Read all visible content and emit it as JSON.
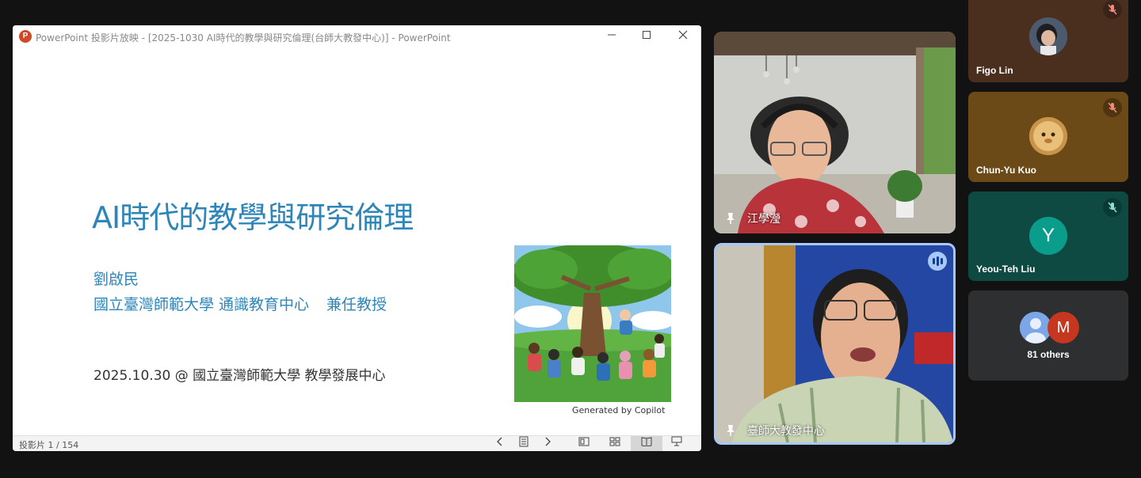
{
  "ppt": {
    "window_title": "PowerPoint 投影片放映 - [2025-1030 AI時代的教學與研究倫理(台師大教發中心)] - PowerPoint",
    "logo_letter": "P",
    "slide": {
      "title": "AI時代的教學與研究倫理",
      "author": "劉啟民",
      "affiliation": "國立臺灣師範大學 通識教育中心",
      "position": "兼任教授",
      "date": "2025.10.30 @ 國立臺灣師範大學 教學發展中心",
      "image_credit": "Generated by Copilot"
    },
    "status": {
      "slide_counter": "投影片 1 / 154"
    }
  },
  "meeting": {
    "main_tiles": [
      {
        "name": "江學瀅"
      },
      {
        "name": "臺師大教發中心"
      }
    ],
    "side_tiles": [
      {
        "name": "Figo Lin",
        "bg": "#4a2e1e"
      },
      {
        "name": "Chun-Yu Kuo",
        "bg": "#6b4a18"
      },
      {
        "name": "Yeou-Teh Liu",
        "bg": "#0f4a42",
        "initial": "Y"
      },
      {
        "label": "81 others",
        "bg": "#2d2f31",
        "initial": "M"
      }
    ]
  },
  "colors": {
    "accent_blue": "#2e86b8",
    "speaker_border": "#a8c7fa",
    "background": "#121212"
  }
}
